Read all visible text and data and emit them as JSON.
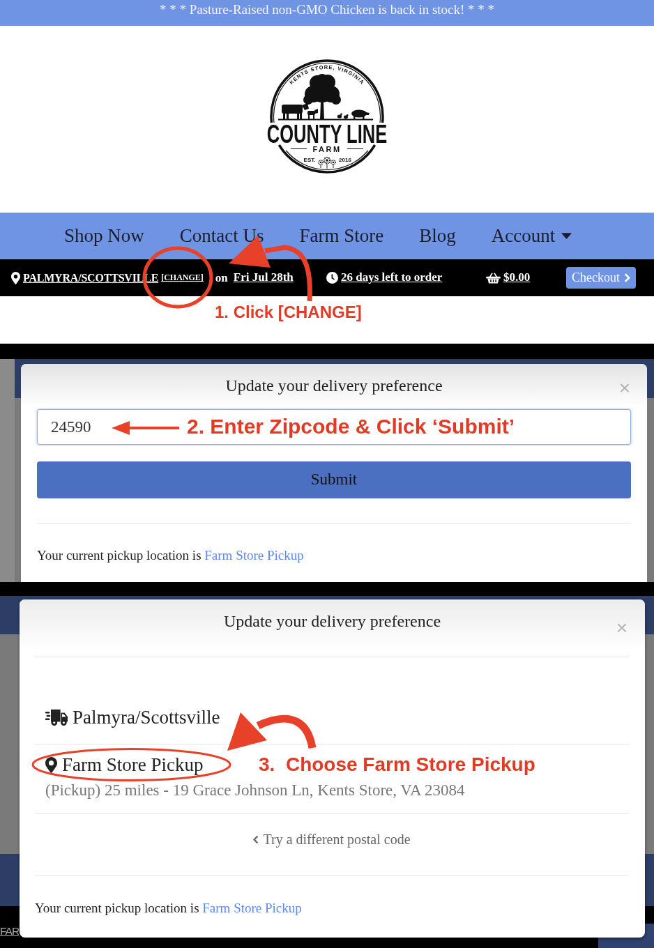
{
  "announcement": {
    "text": "* * * Pasture-Raised non-GMO Chicken is back in stock! * * *"
  },
  "logo": {
    "arc_text": "KENTS STORE, VIRGINIA",
    "title": "COUNTY LINE",
    "subtitle": "FARM",
    "est_label": "EST.",
    "est_year": "2016"
  },
  "nav": {
    "items": [
      {
        "label": "Shop Now",
        "dropdown": false
      },
      {
        "label": "Contact Us",
        "dropdown": false
      },
      {
        "label": "Farm Store",
        "dropdown": false
      },
      {
        "label": "Blog",
        "dropdown": false
      },
      {
        "label": "Account",
        "dropdown": true
      }
    ]
  },
  "order_bar": {
    "location": "PALMYRA/SCOTTSVILLE",
    "change_link": "[CHANGE]",
    "date_prefix": "on",
    "date": "Fri Jul 28th",
    "countdown": "26 days left to order",
    "cart_total": "$0.00",
    "checkout": "Checkout"
  },
  "step_1": {
    "text": "1. Click [CHANGE]"
  },
  "zip_dialog": {
    "title": "Update your delivery preference",
    "close": "×",
    "zipcode": "24590",
    "step_note": "2. Enter Zipcode & Click ‘Submit’",
    "submit": "Submit",
    "current_label": "Your current pickup location is",
    "current_location": "Farm Store Pickup"
  },
  "location_dialog": {
    "title": "Update your delivery preference",
    "close": "×",
    "options": [
      {
        "kind": "delivery",
        "name": "Palmyra/Scottsville",
        "highlighted": false
      },
      {
        "kind": "pickup",
        "name": "Farm Store Pickup",
        "detail": "(Pickup) 25 miles - 19 Grace Johnson Ln, Kents Store, VA 23084",
        "highlighted": true
      }
    ],
    "step_note": "3.  Choose Farm Store Pickup",
    "back_link": "Try a different postal code",
    "current_label": "Your current pickup location is",
    "current_location": "Farm Store Pickup"
  },
  "background_page": {
    "link_fragment": "FAR"
  }
}
